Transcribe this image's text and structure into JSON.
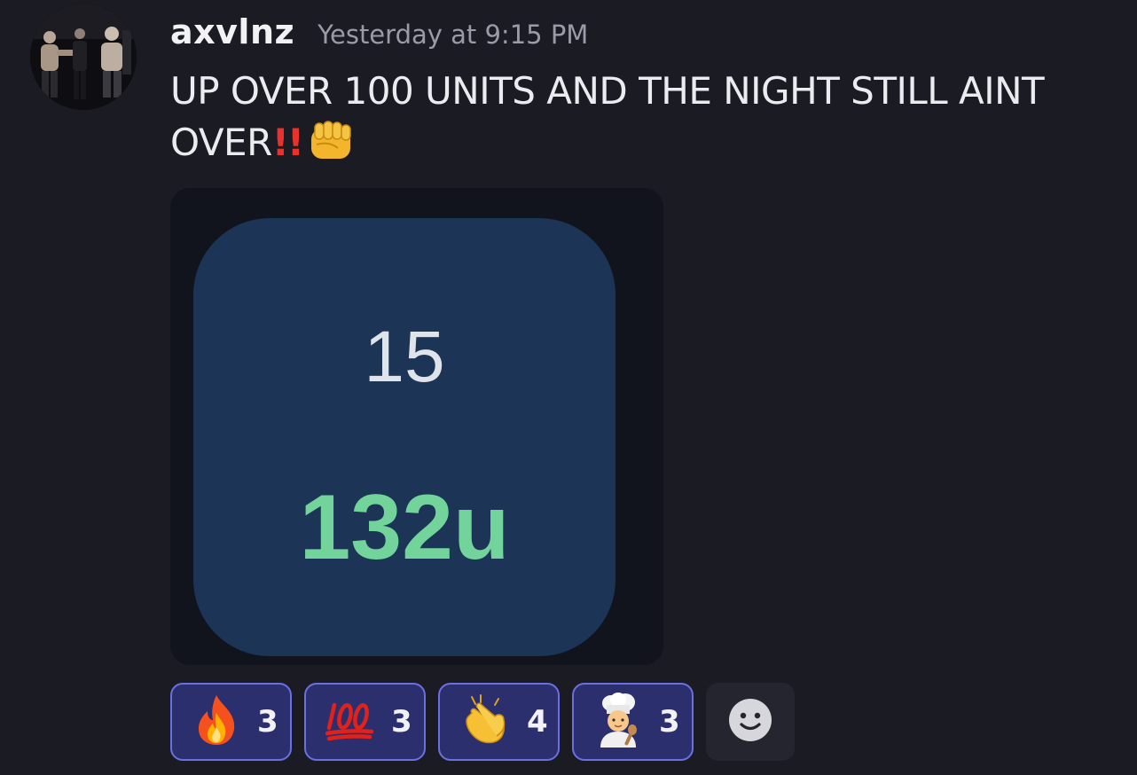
{
  "message": {
    "username": "axvlnz",
    "timestamp": "Yesterday at 9:15 PM",
    "text_line1": "UP OVER 100 UNITS AND THE NIGHT STILL AINT",
    "text_line2": "OVER",
    "text_emphasis": "!!",
    "text_emoji": "oncoming-fist-emoji"
  },
  "attachment": {
    "count": "15",
    "units": "132u"
  },
  "reactions": [
    {
      "emoji": "fire-emoji",
      "count": "3"
    },
    {
      "emoji": "hundred-points-emoji",
      "count": "3"
    },
    {
      "emoji": "clapping-hands-emoji",
      "count": "4"
    },
    {
      "emoji": "cook-emoji",
      "count": "3"
    }
  ],
  "add_reaction": {
    "icon": "smiley-icon"
  },
  "colors": {
    "background": "#1b1b24",
    "tile": "#1c3455",
    "units_green": "#72d39b",
    "reaction_border": "#6b70e0",
    "reaction_bg": "#2b2f6e"
  }
}
